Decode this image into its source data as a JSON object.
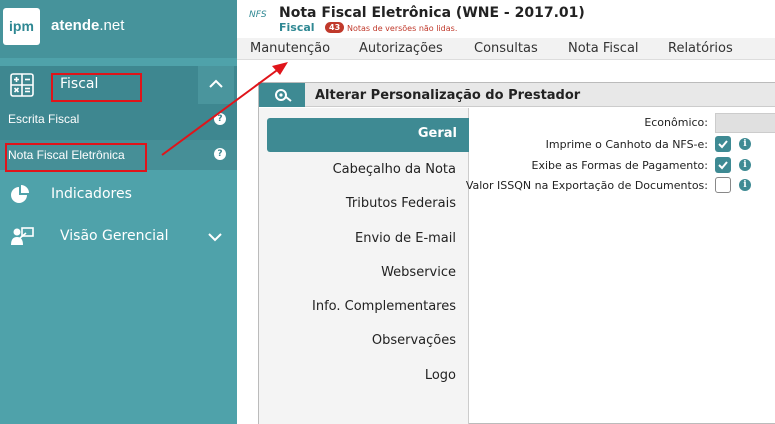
{
  "brand": {
    "logo_text": "ipm",
    "name_bold": "atende",
    "name_light": ".net"
  },
  "sidebar": {
    "fiscal_label": "Fiscal",
    "sub_items": [
      {
        "label": "Escrita Fiscal"
      },
      {
        "label": "Nota Fiscal Eletrônica"
      }
    ],
    "help_glyph": "?",
    "nav": [
      {
        "label": "Indicadores",
        "icon": "pie-chart-icon"
      },
      {
        "label": "Visão Gerencial",
        "icon": "presenter-icon"
      }
    ]
  },
  "header": {
    "logo_text": "NFS",
    "title": "Nota Fiscal Eletrônica (WNE - 2017.01)",
    "module": "Fiscal",
    "badge_count": "43",
    "badge_text": "Notas de versões não lidas."
  },
  "menu": [
    "Manutenção",
    "Autorizações",
    "Consultas",
    "Nota Fiscal",
    "Relatórios"
  ],
  "panel": {
    "title": "Alterar Personalização do Prestador",
    "tabs": [
      "Geral",
      "Cabeçalho da Nota",
      "Tributos Federais",
      "Envio de E-mail",
      "Webservice",
      "Info. Complementares",
      "Observações",
      "Logo"
    ],
    "form": {
      "economico_label": "Econômico:",
      "info_glyph": "i",
      "rows": [
        {
          "label": "Imprime o Canhoto da NFS-e:",
          "checked": true
        },
        {
          "label": "Exibe as Formas de Pagamento:",
          "checked": true
        },
        {
          "label": "Valor ISSQN na Exportação de Documentos:",
          "checked": false
        }
      ]
    }
  },
  "colors": {
    "sidebar": "#4fa2aa",
    "sidebar_dark": "#3e8790",
    "accent": "#3e8a93",
    "highlight": "#e0141a"
  }
}
